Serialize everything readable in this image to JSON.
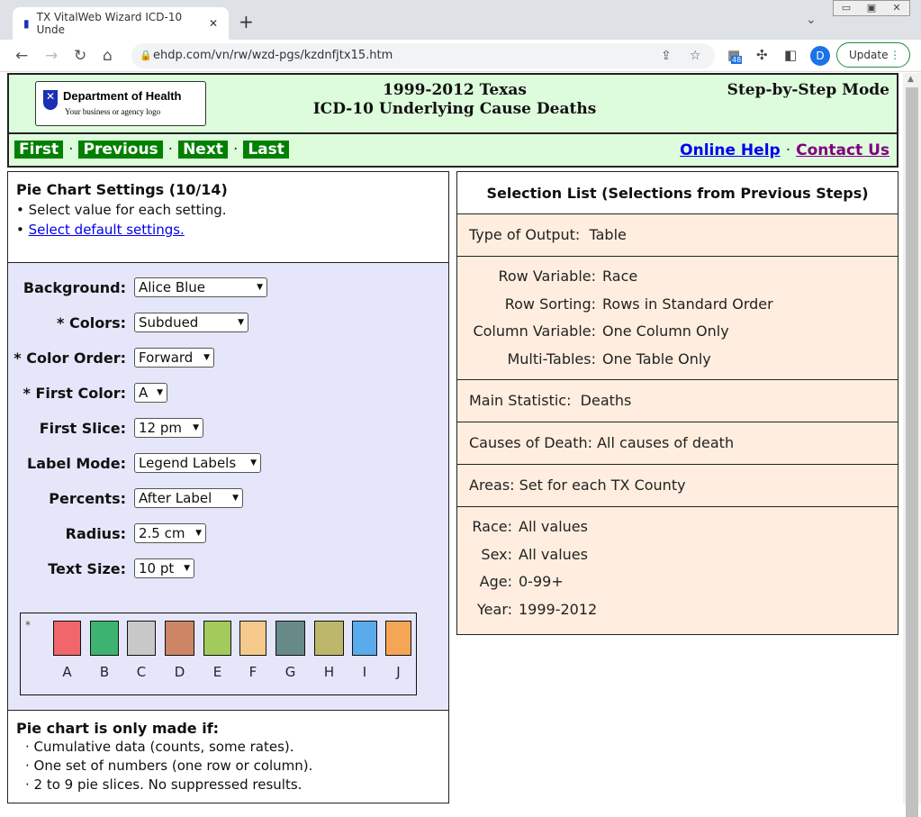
{
  "browser": {
    "tab_title": "TX VitalWeb Wizard ICD-10 Unde",
    "url": "ehdp.com/vn/rw/wzd-pgs/kzdnfjtx15.htm",
    "ext_badge": "48",
    "avatar": "D",
    "update_label": "Update"
  },
  "header": {
    "logo_title": "Department of Health",
    "logo_subtitle": "Your business or agency logo",
    "title_line1": "1999-2012 Texas",
    "title_line2": "ICD-10 Underlying Cause Deaths",
    "mode": "Step-by-Step Mode"
  },
  "nav": {
    "first": "First",
    "previous": "Previous",
    "next": "Next",
    "last": "Last",
    "sep": "·",
    "online_help": "Online Help",
    "contact_us": "Contact Us"
  },
  "left": {
    "title": "Pie Chart Settings (10/14)",
    "bullet1": "Select value for each setting.",
    "bullet2": "Select default settings.",
    "settings": [
      {
        "label": "Background:",
        "value": "Alice Blue"
      },
      {
        "label": "* Colors:",
        "value": "Subdued"
      },
      {
        "label": "* Color Order:",
        "value": "Forward"
      },
      {
        "label": "* First Color:",
        "value": "A"
      },
      {
        "label": "First Slice:",
        "value": "12 pm"
      },
      {
        "label": "Label Mode:",
        "value": "Legend Labels"
      },
      {
        "label": "Percents:",
        "value": "After Label"
      },
      {
        "label": "Radius:",
        "value": "2.5 cm"
      },
      {
        "label": "Text Size:",
        "value": "10 pt"
      }
    ],
    "swatch_star": "*",
    "swatches": [
      {
        "letter": "A",
        "color": "#f0666a"
      },
      {
        "letter": "B",
        "color": "#3cb371"
      },
      {
        "letter": "C",
        "color": "#c8c8c8"
      },
      {
        "letter": "D",
        "color": "#cd8565"
      },
      {
        "letter": "E",
        "color": "#a2cb5c"
      },
      {
        "letter": "F",
        "color": "#f5c98c"
      },
      {
        "letter": "G",
        "color": "#678a88"
      },
      {
        "letter": "H",
        "color": "#bdb76b"
      },
      {
        "letter": "I",
        "color": "#5aabec"
      },
      {
        "letter": "J",
        "color": "#f5a556"
      }
    ],
    "note_title": "Pie chart is only made if:",
    "notes": [
      "· Cumulative data (counts, some rates).",
      "· One set of numbers (one row or column).",
      "· 2 to 9 pie slices. No suppressed results."
    ]
  },
  "right": {
    "title": "Selection List (Selections from Previous Steps)",
    "output": {
      "k": "Type of Output:",
      "v": "Table"
    },
    "table": [
      {
        "k": "Row Variable:",
        "v": "Race"
      },
      {
        "k": "Row Sorting:",
        "v": "Rows in Standard Order"
      },
      {
        "k": "Column Variable:",
        "v": "One Column Only"
      },
      {
        "k": "Multi-Tables:",
        "v": "One Table Only"
      }
    ],
    "statistic": {
      "k": "Main Statistic:",
      "v": "Deaths"
    },
    "causes": {
      "k": "Causes of Death:",
      "v": "All causes of death"
    },
    "areas": {
      "k": "Areas:",
      "v": "Set for each TX County"
    },
    "filters": [
      {
        "k": "Race:",
        "v": "All values"
      },
      {
        "k": "Sex:",
        "v": "All values"
      },
      {
        "k": "Age:",
        "v": "0-99+"
      },
      {
        "k": "Year:",
        "v": "1999-2012"
      }
    ]
  }
}
